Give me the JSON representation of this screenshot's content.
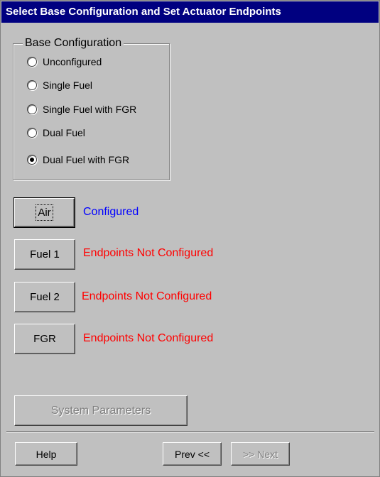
{
  "window": {
    "title": "Select Base Configuration and Set Actuator Endpoints"
  },
  "base_configuration": {
    "legend": "Base Configuration",
    "options": [
      {
        "label": "Unconfigured",
        "selected": false
      },
      {
        "label": "Single Fuel",
        "selected": false
      },
      {
        "label": "Single Fuel with FGR",
        "selected": false
      },
      {
        "label": "Dual Fuel",
        "selected": false
      },
      {
        "label": "Dual Fuel with FGR",
        "selected": true
      }
    ]
  },
  "actuators": [
    {
      "button": "Air",
      "status": "Configured",
      "status_color": "#0000ff"
    },
    {
      "button": "Fuel 1",
      "status": "Endpoints Not Configured",
      "status_color": "#ff0000"
    },
    {
      "button": "Fuel 2",
      "status": "Endpoints Not Configured",
      "status_color": "#ff0000"
    },
    {
      "button": "FGR",
      "status": "Endpoints Not Configured",
      "status_color": "#ff0000"
    }
  ],
  "system_parameters_button": {
    "label": "System Parameters",
    "enabled": false
  },
  "footer": {
    "help_label": "Help",
    "prev_label": "Prev <<",
    "next_label": ">> Next",
    "next_enabled": false
  }
}
